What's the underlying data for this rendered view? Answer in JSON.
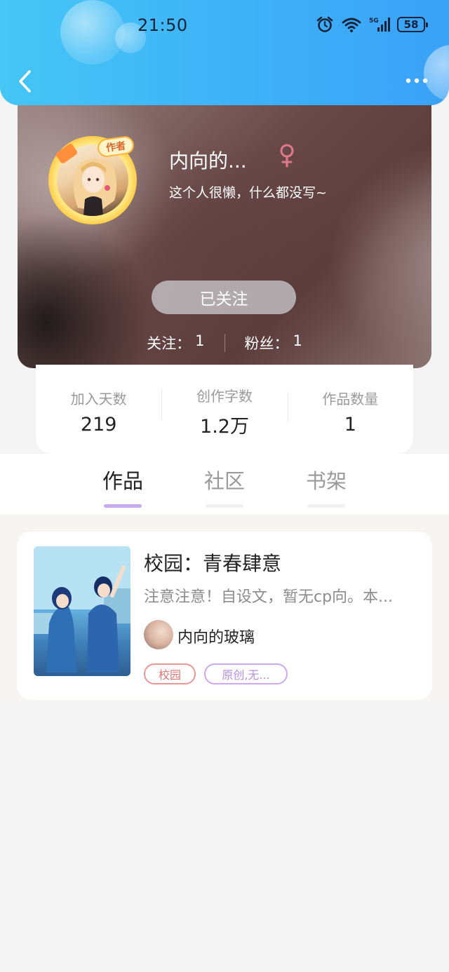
{
  "status_bar": {
    "time": "21:50",
    "battery": "58"
  },
  "profile": {
    "username": "内向的...",
    "bio": "这个人很懒，什么都没写~",
    "avatar_badge": "作者",
    "follow_button": "已关注",
    "following_label": "关注：",
    "following_count": "1",
    "fans_label": "粉丝：",
    "fans_count": "1"
  },
  "stats": [
    {
      "label": "加入天数",
      "value": "219"
    },
    {
      "label": "创作字数",
      "value": "1.2万"
    },
    {
      "label": "作品数量",
      "value": "1"
    }
  ],
  "tabs": [
    {
      "label": "作品",
      "active": true
    },
    {
      "label": "社区",
      "active": false
    },
    {
      "label": "书架",
      "active": false
    }
  ],
  "works": [
    {
      "title": "校园：青春肆意",
      "description": "注意注意！自设文，暂无cp向。本...",
      "author": "内向的玻璃",
      "tags": [
        "校园",
        "原创,无..."
      ]
    }
  ],
  "colors": {
    "header_gradient_start": "#45c6f5",
    "header_gradient_end": "#3aa2f7",
    "tab_indicator": "#c8aaf0",
    "gender_icon": "#e07a8a",
    "tag_1": "#e07474",
    "tag_2": "#b68ee3"
  },
  "icons": {
    "back": "chevron-left-icon",
    "more": "more-dots-icon",
    "gender": "female-icon",
    "alarm": "alarm-icon",
    "wifi": "wifi-icon",
    "signal": "signal-icon"
  }
}
